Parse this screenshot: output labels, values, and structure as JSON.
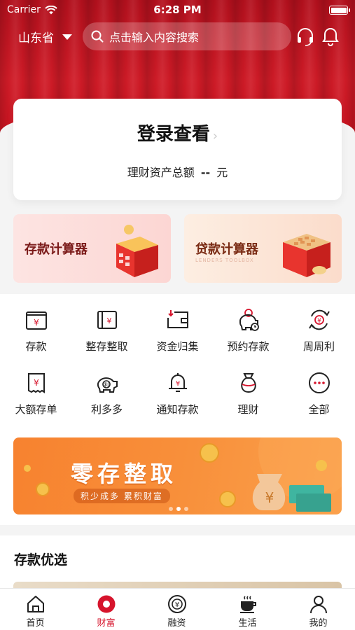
{
  "status_bar": {
    "carrier": "Carrier",
    "time": "6:28 PM"
  },
  "header": {
    "province": "山东省",
    "search_placeholder": "点击输入内容搜索"
  },
  "login_card": {
    "title": "登录查看",
    "asset_label": "理财资产总额",
    "asset_value": "--",
    "asset_unit": "元"
  },
  "calculators": [
    {
      "label": "存款计算器",
      "sub": ""
    },
    {
      "label": "贷款计算器",
      "sub": "LENDERS TOOLBOX"
    }
  ],
  "services": [
    {
      "label": "存款",
      "icon": "yen-card-icon"
    },
    {
      "label": "整存整取",
      "icon": "yen-book-icon"
    },
    {
      "label": "资金归集",
      "icon": "wallet-in-icon"
    },
    {
      "label": "预约存款",
      "icon": "piggy-clock-icon"
    },
    {
      "label": "周周利",
      "icon": "yen-cycle-icon"
    },
    {
      "label": "大额存单",
      "icon": "yen-ticket-icon"
    },
    {
      "label": "利多多",
      "icon": "piggy-bank-icon"
    },
    {
      "label": "通知存款",
      "icon": "bell-yen-icon"
    },
    {
      "label": "理财",
      "icon": "money-bag-icon"
    },
    {
      "label": "全部",
      "icon": "more-dots-icon"
    }
  ],
  "banner": {
    "title": "零存整取",
    "subtitle": "积少成多 累积财富",
    "slides": 3,
    "active_slide": 2
  },
  "section": {
    "title": "存款优选"
  },
  "tabs": [
    {
      "label": "首页",
      "icon": "home-icon"
    },
    {
      "label": "财富",
      "icon": "wealth-icon"
    },
    {
      "label": "融资",
      "icon": "finance-icon"
    },
    {
      "label": "生活",
      "icon": "coffee-icon"
    },
    {
      "label": "我的",
      "icon": "user-icon"
    }
  ],
  "active_tab": 1,
  "colors": {
    "brand_red": "#d6142c",
    "banner_orange": "#f88f3a"
  }
}
